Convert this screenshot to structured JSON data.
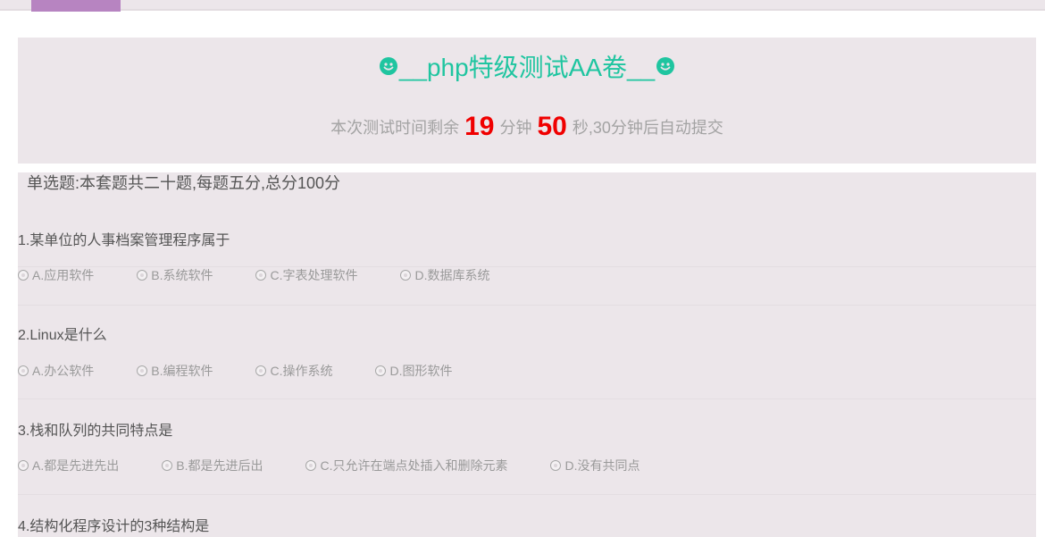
{
  "header": {
    "title": "__php特级测试AA卷__",
    "timer_prefix": "本次测试时间剩余",
    "minutes": "19",
    "minutes_unit": "分钟",
    "seconds": "50",
    "timer_suffix": "秒,30分钟后自动提交"
  },
  "section": {
    "title": "单选题:本套题共二十题,每题五分,总分100分"
  },
  "questions": [
    {
      "text": "1.某单位的人事档案管理程序属于",
      "options": [
        "A.应用软件",
        "B.系统软件",
        "C.字表处理软件",
        "D.数据库系统"
      ]
    },
    {
      "text": "2.Linux是什么",
      "options": [
        "A.办公软件",
        "B.编程软件",
        "C.操作系统",
        "D.图形软件"
      ]
    },
    {
      "text": "3.栈和队列的共同特点是",
      "options": [
        "A.都是先进先出",
        "B.都是先进后出",
        "C.只允许在端点处插入和删除元素",
        "D.没有共同点"
      ]
    },
    {
      "text": "4.结构化程序设计的3种结构是",
      "options": []
    }
  ],
  "colors": {
    "accent": "#1fc5a0",
    "timer_number": "#f00000",
    "panel_background": "#ece6ea",
    "top_tab": "#b784c1"
  },
  "icons": {
    "title_decoration": "smiley-face-icon",
    "option_marker": "radio-button-icon"
  }
}
